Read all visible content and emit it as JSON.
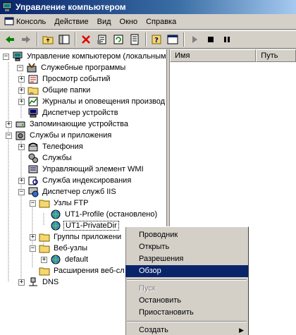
{
  "window": {
    "title": "Управление компьютером"
  },
  "menubar": {
    "items": [
      "Консоль",
      "Действие",
      "Вид",
      "Окно",
      "Справка"
    ]
  },
  "toolbar": {
    "buttons": [
      "back-icon",
      "forward-icon",
      "up-folder-icon",
      "show-tree-icon",
      "delete-icon",
      "properties-icon",
      "refresh-icon",
      "export-icon",
      "help-icon",
      "console-tree-icon",
      "play-icon",
      "stop-icon",
      "pause-icon"
    ]
  },
  "tree": {
    "root": "Управление компьютером (локальным)",
    "system_tools": "Служебные программы",
    "event_viewer": "Просмотр событий",
    "shared_folders": "Общие папки",
    "logs_alerts": "Журналы и оповещения производ",
    "device_manager": "Диспетчер устройств",
    "storage": "Запоминающие устройства",
    "services_apps": "Службы и приложения",
    "telephony": "Телефония",
    "services": "Службы",
    "wmi": "Управляющий элемент WMI",
    "indexing": "Служба индексирования",
    "iis": "Диспетчер служб IIS",
    "ftp_sites": "Узлы FTP",
    "ut1_profile": "UT1-Profile (остановлено)",
    "ut1_private": "UT1-PrivateDir",
    "app_groups": "Группы приложени",
    "web_sites": "Веб-узлы",
    "default_site": "default",
    "web_ext": "Расширения веб-сл",
    "dns": "DNS"
  },
  "list": {
    "columns": [
      "Имя",
      "Путь"
    ]
  },
  "context_menu": {
    "items": [
      {
        "label": "Проводник",
        "state": "normal"
      },
      {
        "label": "Открыть",
        "state": "normal"
      },
      {
        "label": "Разрешения",
        "state": "normal"
      },
      {
        "label": "Обзор",
        "state": "highlighted"
      },
      {
        "label": "Пуск",
        "state": "disabled"
      },
      {
        "label": "Остановить",
        "state": "normal"
      },
      {
        "label": "Приостановить",
        "state": "normal"
      },
      {
        "label": "Создать",
        "state": "submenu"
      }
    ]
  }
}
